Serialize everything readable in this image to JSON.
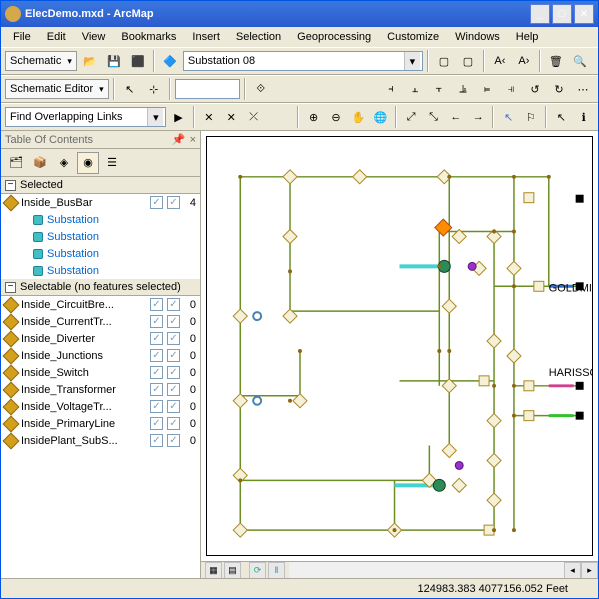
{
  "title": "ElecDemo.mxd - ArcMap",
  "menu": {
    "file": "File",
    "edit": "Edit",
    "view": "View",
    "bookmarks": "Bookmarks",
    "insert": "Insert",
    "selection": "Selection",
    "geoprocessing": "Geoprocessing",
    "customize": "Customize",
    "windows": "Windows",
    "help": "Help"
  },
  "toolbar1": {
    "schematic": "Schematic",
    "substation": "Substation 08"
  },
  "toolbar2": {
    "editor": "Schematic Editor"
  },
  "toolbar3": {
    "find": "Find Overlapping Links"
  },
  "toc": {
    "title": "Table Of Contents",
    "selected_header": "Selected",
    "selectable_header": "Selectable (no features selected)",
    "busbar": {
      "name": "Inside_BusBar",
      "count": "4"
    },
    "subs": [
      "Substation",
      "Substation",
      "Substation",
      "Substation"
    ],
    "layers": [
      {
        "name": "Inside_CircuitBre...",
        "count": "0"
      },
      {
        "name": "Inside_CurrentTr...",
        "count": "0"
      },
      {
        "name": "Inside_Diverter",
        "count": "0"
      },
      {
        "name": "Inside_Junctions",
        "count": "0"
      },
      {
        "name": "Inside_Switch",
        "count": "0"
      },
      {
        "name": "Inside_Transformer",
        "count": "0"
      },
      {
        "name": "Inside_VoltageTr...",
        "count": "0"
      },
      {
        "name": "Inside_PrimaryLine",
        "count": "0"
      },
      {
        "name": "InsidePlant_SubS...",
        "count": "0"
      }
    ]
  },
  "map_labels": {
    "goldmine": "GOLDMINE",
    "harisson": "HARISSON"
  },
  "status": {
    "coords": "124983.383  4077156.052 Feet"
  }
}
